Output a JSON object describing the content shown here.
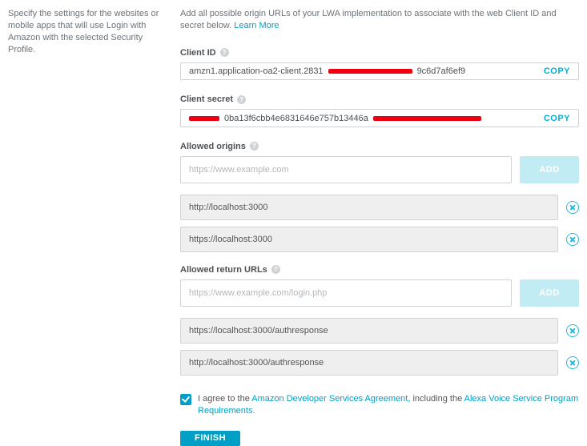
{
  "sidebar": {
    "description": "Specify the settings for the websites or mobile apps that will use Login with Amazon with the selected Security Profile."
  },
  "intro": {
    "text": "Add all possible origin URLs of your LWA implementation to associate with the web Client ID and secret below. ",
    "learn_more": "Learn More"
  },
  "client_id": {
    "label": "Client ID",
    "prefix": "amzn1.application-oa2-client.2831",
    "suffix": "9c6d7af6ef9",
    "copy": "COPY"
  },
  "client_secret": {
    "label": "Client secret",
    "mid": "0ba13f6cbb4e6831646e757b13446a",
    "copy": "COPY"
  },
  "allowed_origins": {
    "label": "Allowed origins",
    "placeholder": "https://www.example.com",
    "add": "ADD",
    "items": [
      "http://localhost:3000",
      "https://localhost:3000"
    ]
  },
  "allowed_return_urls": {
    "label": "Allowed return URLs",
    "placeholder": "https://www.example.com/login.php",
    "add": "ADD",
    "items": [
      "https://localhost:3000/authresponse",
      "http://localhost:3000/authresponse"
    ]
  },
  "agreement": {
    "pre": " I agree to the ",
    "link1": " Amazon Developer Services Agreement, ",
    "mid": " including the ",
    "link2": " Alexa Voice Service Program Requirements."
  },
  "finish": "FINISH"
}
